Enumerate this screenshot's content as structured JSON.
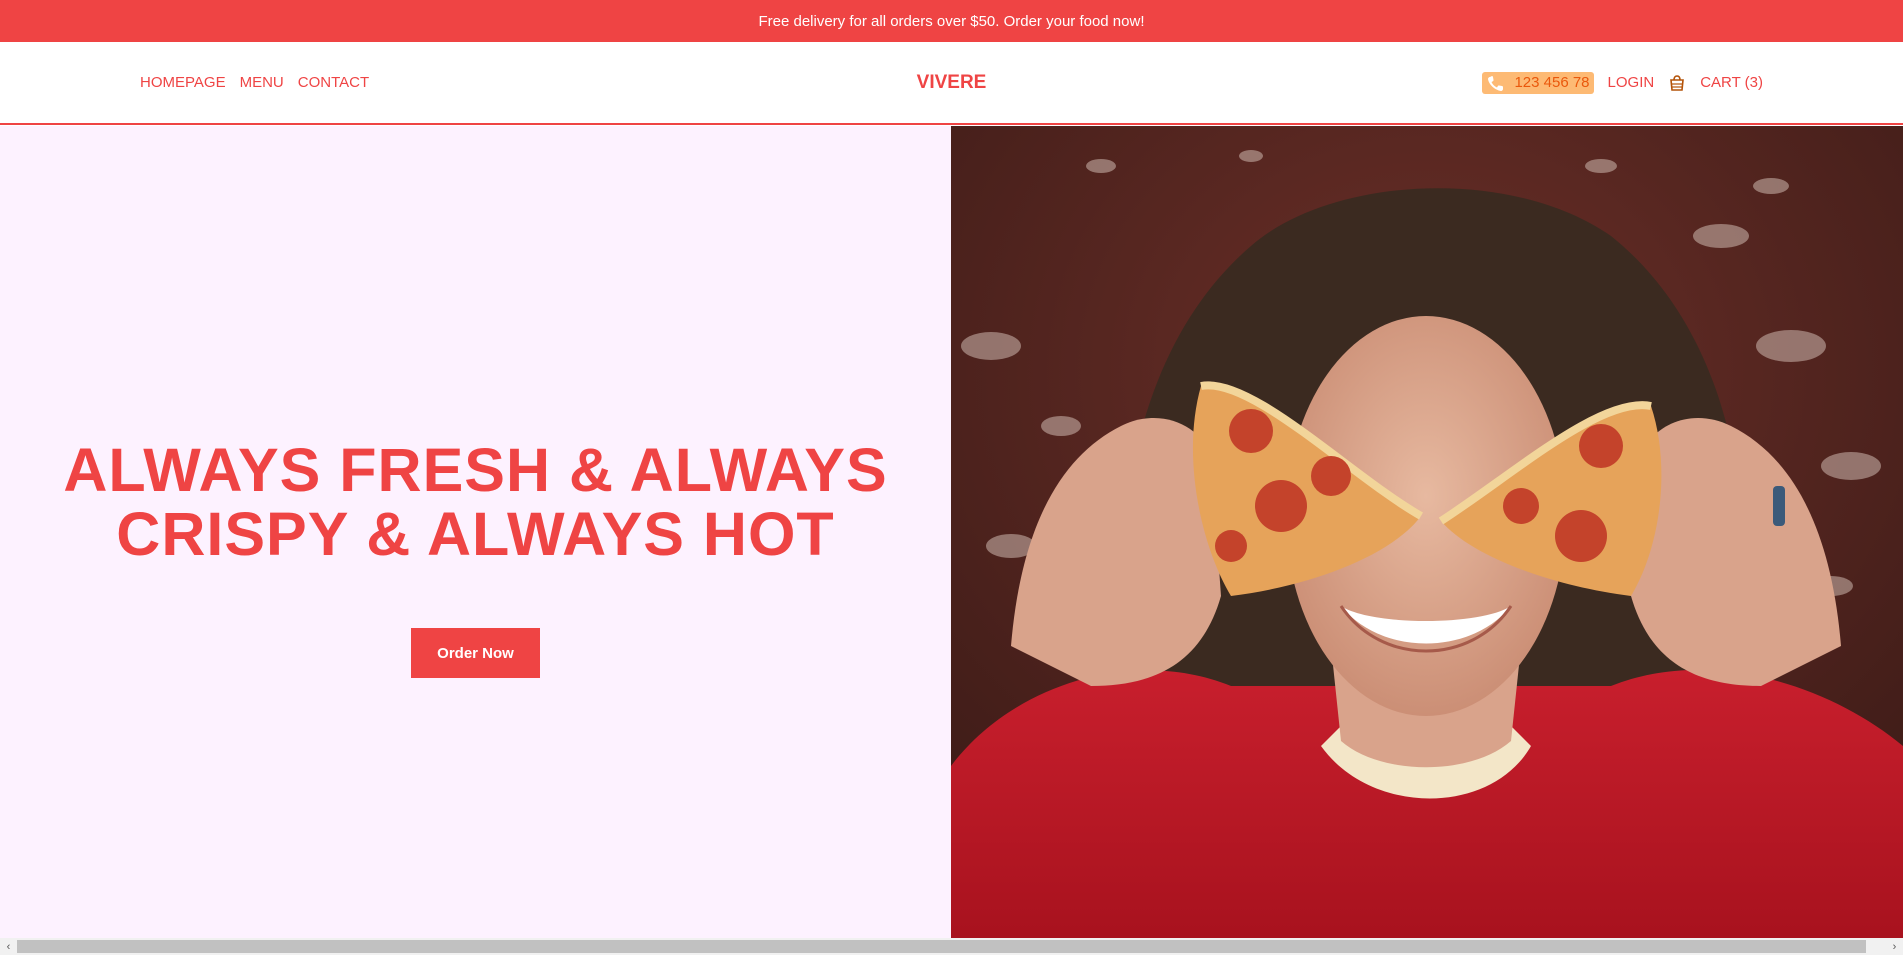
{
  "promo": {
    "text": "Free delivery for all orders over $50. Order your food now!"
  },
  "nav": {
    "links": [
      "HOMEPAGE",
      "MENU",
      "CONTACT"
    ],
    "brand": "VIVERE",
    "phone": "123 456 78",
    "login": "LOGIN",
    "cart": "CART (3)"
  },
  "hero": {
    "title_line1": "ALWAYS FRESH & ALWAYS",
    "title_line2": "CRISPY & ALWAYS HOT",
    "cta": "Order Now"
  },
  "scrollbar": {
    "left_arrow": "‹",
    "right_arrow": "›"
  },
  "colors": {
    "accent": "#ef4444",
    "hero_bg": "#fdf2ff",
    "phone_bg": "#fdba74",
    "phone_text": "#ea580c"
  },
  "icons": [
    "phone-icon",
    "cart-icon"
  ]
}
